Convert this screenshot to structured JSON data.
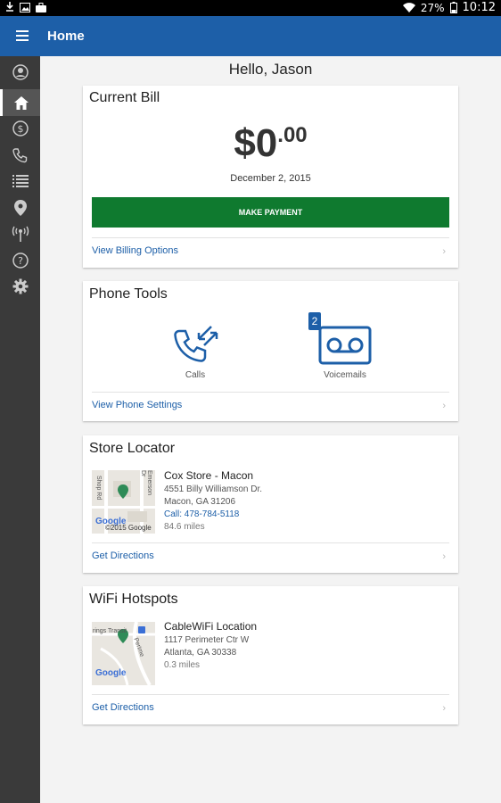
{
  "status_bar": {
    "battery": "27%",
    "time": "10:12",
    "icons": [
      "download-icon",
      "image-icon",
      "briefcase-icon",
      "wifi-icon",
      "battery-icon"
    ]
  },
  "app_bar": {
    "title": "Home",
    "menu_icon": "hamburger-menu-icon",
    "color": "#1d5fa8"
  },
  "side_nav": {
    "items": [
      {
        "icon": "account-icon"
      },
      {
        "icon": "home-icon",
        "active": true
      },
      {
        "icon": "billing-dollar-icon"
      },
      {
        "icon": "phone-icon"
      },
      {
        "icon": "list-icon"
      },
      {
        "icon": "location-pin-icon"
      },
      {
        "icon": "wifi-hotspot-icon"
      },
      {
        "icon": "help-icon"
      },
      {
        "icon": "settings-gear-icon"
      }
    ]
  },
  "greeting": "Hello, Jason",
  "current_bill": {
    "title": "Current Bill",
    "amount_dollars": "$0",
    "amount_cents": ".00",
    "date": "December 2, 2015",
    "pay_button": "MAKE PAYMENT",
    "pay_color": "#0f7a2f",
    "link": "View Billing Options"
  },
  "phone_tools": {
    "title": "Phone Tools",
    "calls_label": "Calls",
    "voicemails_label": "Voicemails",
    "voicemail_count": "2",
    "link": "View Phone Settings"
  },
  "store_locator": {
    "title": "Store Locator",
    "name": "Cox Store - Macon",
    "address1": "4551 Billy Williamson Dr.",
    "address2": "Macon, GA 31206",
    "phone": "Call: 478-784-5118",
    "distance": "84.6 miles",
    "map_street1": "Shop Rd",
    "map_street2": "Emerson Dr",
    "map_brand": "Google",
    "map_copyright": "©2015 Google",
    "link": "Get Directions"
  },
  "wifi_hotspots": {
    "title": "WiFi Hotspots",
    "name": "CableWiFi Location",
    "address1": "1117 Perimeter Ctr W",
    "address2": "Atlanta, GA 30338",
    "distance": "0.3 miles",
    "map_street1": "rings Transit",
    "map_street2": "Perime",
    "map_brand": "Google",
    "link": "Get Directions"
  },
  "chevron": "›"
}
